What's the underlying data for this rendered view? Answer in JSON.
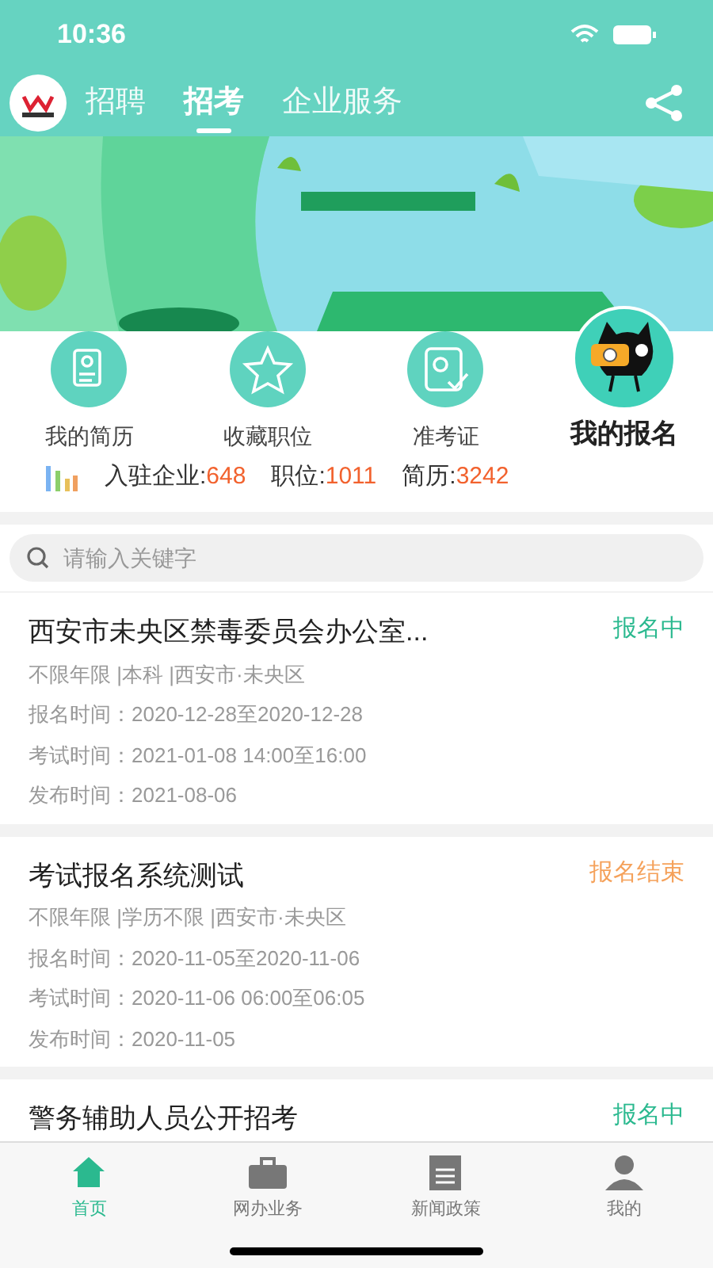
{
  "status_bar": {
    "time": "10:36"
  },
  "header": {
    "tabs": [
      {
        "label": "招聘",
        "selected": false
      },
      {
        "label": "招考",
        "selected": true
      },
      {
        "label": "企业服务",
        "selected": false
      }
    ]
  },
  "quick_links": [
    {
      "label": "我的简历",
      "kind": "resume"
    },
    {
      "label": "收藏职位",
      "kind": "star"
    },
    {
      "label": "准考证",
      "kind": "certificate"
    },
    {
      "label": "我的报名",
      "kind": "featured"
    }
  ],
  "stats": [
    {
      "label": "入驻企业:",
      "value": "648"
    },
    {
      "label": "职位:",
      "value": "1011"
    },
    {
      "label": "简历:",
      "value": "3242"
    }
  ],
  "search": {
    "placeholder": "请输入关键字"
  },
  "exams": [
    {
      "title": "西安市未央区禁毒委员会办公室...",
      "status": "报名中",
      "kind": "open",
      "meta": "不限年限 |本科 |西安市·未央区",
      "lines": [
        "报名时间：2020-12-28至2020-12-28",
        "考试时间：2021-01-08 14:00至16:00",
        "发布时间：2021-08-06"
      ]
    },
    {
      "title": "考试报名系统测试",
      "status": "报名结束",
      "kind": "closed",
      "meta": "不限年限 |学历不限 |西安市·未央区",
      "lines": [
        "报名时间：2020-11-05至2020-11-06",
        "考试时间：2020-11-06 06:00至06:05",
        "发布时间：2020-11-05"
      ]
    },
    {
      "title": "警务辅助人员公开招考",
      "status": "报名中",
      "kind": "open"
    }
  ],
  "bottom_nav": [
    {
      "label": "首页",
      "kind": "home",
      "selected": true
    },
    {
      "label": "网办业务",
      "kind": "briefcase",
      "selected": false
    },
    {
      "label": "新闻政策",
      "kind": "news",
      "selected": false
    },
    {
      "label": "我的",
      "kind": "person",
      "selected": false
    }
  ]
}
